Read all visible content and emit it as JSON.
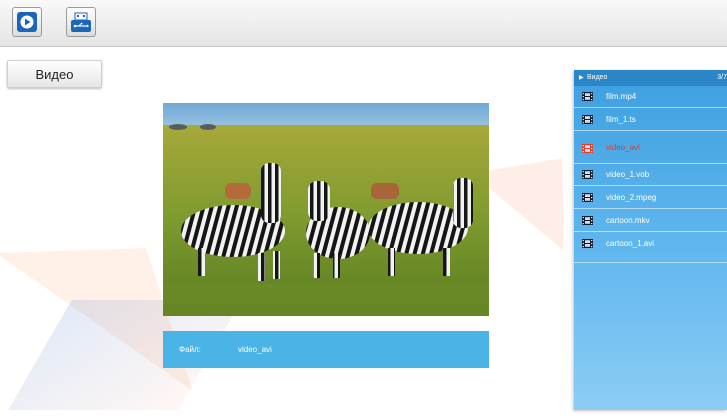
{
  "toolbar": {
    "buttons": [
      {
        "icon": "play-icon"
      },
      {
        "icon": "usb-icon"
      }
    ]
  },
  "category_tab": "Видео",
  "info": {
    "file_label": "Файл:",
    "file_value": "video_avi"
  },
  "playlist": {
    "header_title": "Видео",
    "counter": "3/7",
    "items": [
      {
        "name": "film.mp4",
        "active": false
      },
      {
        "name": "film_1.ts",
        "active": false
      },
      {
        "name": "video_avi",
        "active": true
      },
      {
        "name": "video_1.vob",
        "active": false
      },
      {
        "name": "video_2.mpeg",
        "active": false
      },
      {
        "name": "cartoon.mkv",
        "active": false
      },
      {
        "name": "cartoon_1.avi",
        "active": false
      }
    ]
  },
  "colors": {
    "accent": "#4ab4e6",
    "panel": "#3d9fe0",
    "active_item": "#e03a2a",
    "icon_blue": "#1b66b8"
  }
}
